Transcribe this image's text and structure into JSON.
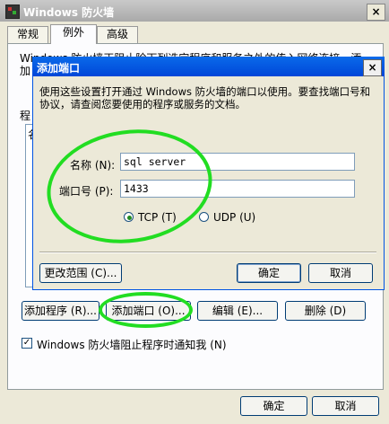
{
  "outer_window": {
    "title": "Windows 防火墙",
    "close_glyph": "×"
  },
  "tabs": [
    {
      "label": "常规"
    },
    {
      "label": "例外"
    },
    {
      "label": "高级"
    }
  ],
  "background_panel": {
    "description_line1": "Windows 防火墙正阻止除下列选定程序和服务之外的传入网络连接。添",
    "description_line2": "加",
    "programs_label": "程",
    "list_header_fragment": "名",
    "buttons": {
      "add_program": "添加程序 (R)...",
      "add_port": "添加端口 (O)...",
      "edit": "编辑 (E)...",
      "delete": "删除 (D)"
    },
    "notify_checkbox": {
      "label": "Windows 防火墙阻止程序时通知我 (N)",
      "checked_glyph": "✓"
    }
  },
  "footer": {
    "ok": "确定",
    "cancel": "取消"
  },
  "dialog": {
    "title": "添加端口",
    "close_glyph": "×",
    "description": "使用这些设置打开通过 Windows 防火墙的端口以使用。要查找端口号和协议，请查阅您要使用的程序或服务的文档。",
    "name_label": "名称 (N):",
    "name_value": "sql server",
    "port_label": "端口号 (P):",
    "port_value": "1433",
    "tcp_label": "TCP (T)",
    "udp_label": "UDP (U)",
    "selected_protocol": "TCP",
    "change_scope": "更改范围 (C)...",
    "ok": "确定",
    "cancel": "取消"
  },
  "colors": {
    "annotation_circle": "#22DD22",
    "dialog_title": "#0A5CE0"
  }
}
